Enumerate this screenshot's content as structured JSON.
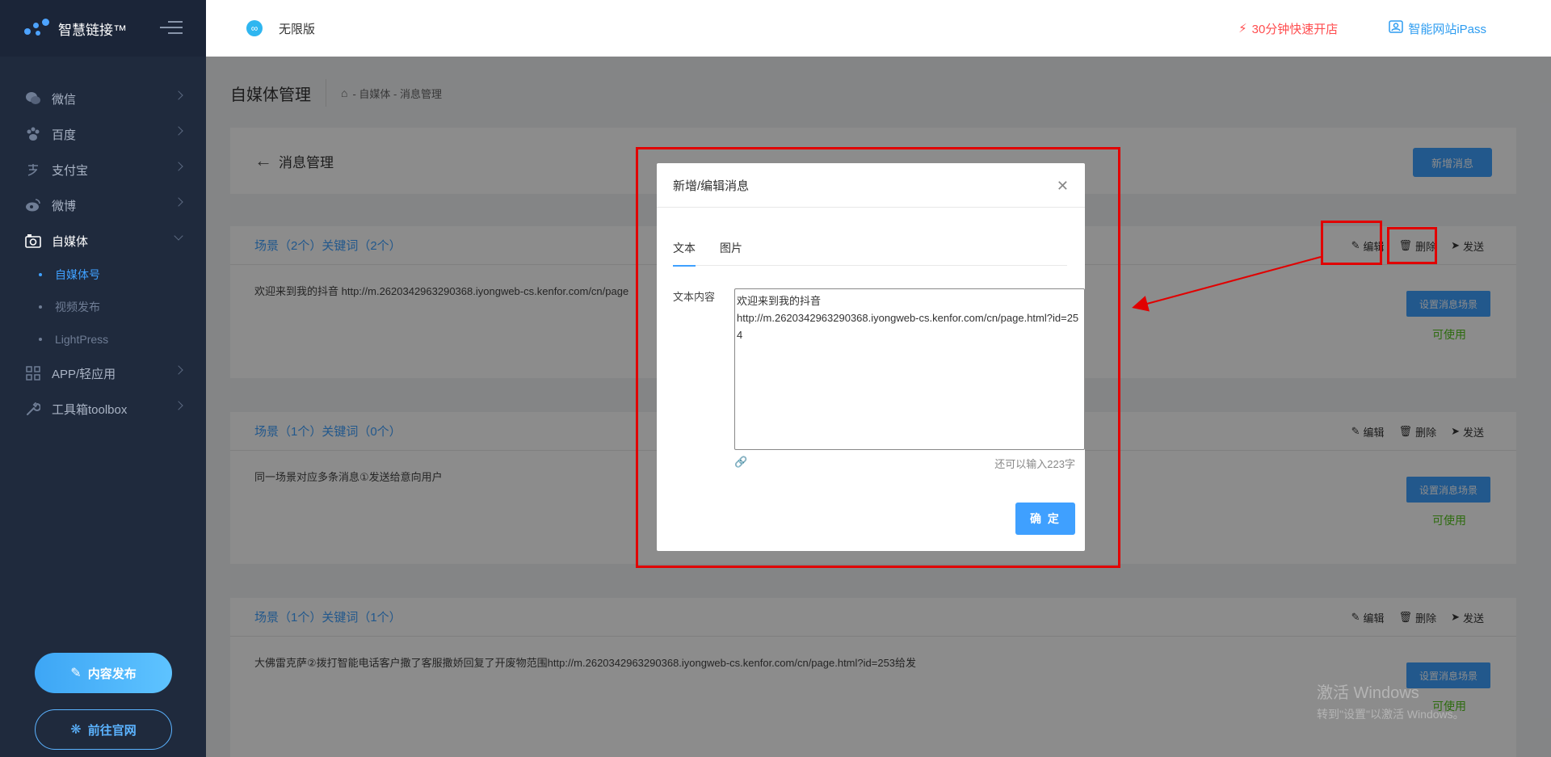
{
  "app": {
    "name": "智慧链接™"
  },
  "sidebar": {
    "items": [
      {
        "label": "微信",
        "icon": "wechat-icon"
      },
      {
        "label": "百度",
        "icon": "baidu-paw-icon"
      },
      {
        "label": "支付宝",
        "icon": "alipay-icon"
      },
      {
        "label": "微博",
        "icon": "weibo-icon"
      },
      {
        "label": "自媒体",
        "icon": "camera-icon"
      },
      {
        "label": "APP/轻应用",
        "icon": "app-grid-icon"
      },
      {
        "label": "工具箱toolbox",
        "icon": "wrench-icon"
      }
    ],
    "submenu": [
      {
        "label": "自媒体号"
      },
      {
        "label": "视频发布"
      },
      {
        "label": "LightPress"
      }
    ],
    "publish_label": "内容发布",
    "site_label": "前往官网"
  },
  "topbar": {
    "edition": "无限版",
    "quick_open": "30分钟快速开店",
    "ipass": "智能网站iPass"
  },
  "page": {
    "title": "自媒体管理",
    "breadcrumb": "- 自媒体 - 消息管理",
    "section_title": "消息管理",
    "new_button": "新增消息"
  },
  "scenes": [
    {
      "title": "场景（2个）关键词（2个）",
      "message": "欢迎来到我的抖音 http://m.2620342963290368.iyongweb-cs.kenfor.com/cn/page",
      "set_button": "设置消息场景",
      "status": "可使用"
    },
    {
      "title": "场景（1个）关键词（0个）",
      "message": "同一场景对应多条消息①发送给意向用户",
      "set_button": "设置消息场景",
      "status": "可使用"
    },
    {
      "title": "场景（1个）关键词（1个）",
      "message": "大佛雷克萨②拨打智能电话客户撒了客服撒娇回复了开废物范围http://m.2620342963290368.iyongweb-cs.kenfor.com/cn/page.html?id=253给发",
      "set_button": "设置消息场景",
      "status": "可使用"
    }
  ],
  "actions": {
    "edit": "编辑",
    "delete": "删除",
    "send": "发送"
  },
  "modal": {
    "title": "新增/编辑消息",
    "tabs": [
      "文本",
      "图片"
    ],
    "field_label": "文本内容",
    "content": "欢迎来到我的抖音\nhttp://m.2620342963290368.iyongweb-cs.kenfor.com/cn/page.html?id=254",
    "char_count": "还可以输入223字",
    "confirm": "确 定"
  },
  "watermark": {
    "line1": "激活 Windows",
    "line2": "转到\"设置\"以激活 Windows。"
  },
  "colors": {
    "primary": "#3fa0ff",
    "sidebar_bg": "#1f2a3d",
    "danger": "#ff4d4f",
    "success": "#52c41a",
    "annotation": "#e10000"
  }
}
